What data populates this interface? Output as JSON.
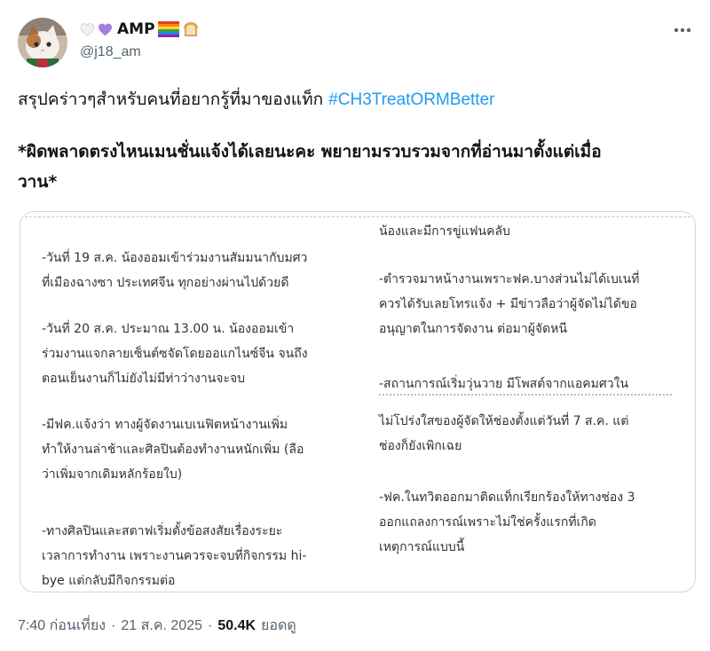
{
  "user": {
    "display_name": "AMP",
    "handle": "@j18_am"
  },
  "icons": {
    "more": "more-dots-icon",
    "heart_white": "white-heart-icon",
    "heart_purple": "purple-heart-icon",
    "flag": "rainbow-flag-icon",
    "bread": "bread-icon",
    "avatar": "cat-avatar"
  },
  "colors": {
    "hashtag": "#1d9bf0",
    "secondary": "#536471",
    "border": "#cfd9de"
  },
  "tweet": {
    "line1_text": "สรุปคร่าวๆสำหรับคนที่อยากรู้ที่มาของแท็ก ",
    "hashtag": "#CH3TreatORMBetter",
    "note_line1": "*ผิดพลาดตรงไหนเมนชั่นแจ้งได้เลยนะคะ พยายามรวบรวมจากที่อ่านมาตั้งแต่เมื่อ",
    "note_line2": "วาน*"
  },
  "media": {
    "left": [
      [
        "-วันที่ 19 ส.ค. น้องออมเข้าร่วมงานสัมมนากับมศว",
        "ที่เมืองฉางซา ประเทศจีน ทุกอย่างผ่านไปด้วยดี"
      ],
      [
        "-วันที่ 20 ส.ค. ประมาณ 13.00 น. น้องออมเข้า",
        "ร่วมงานแจกลายเซ็นต์ซจัดโดยออแกไนซ์จีน จนถึง",
        "ตอนเย็นงานก็ไม่ยังไม่มีท่าว่างานจะจบ"
      ],
      [
        "-มีฟค.แจ้งว่า ทางผู้จัดงานเบเนฟิตหน้างานเพิ่ม",
        "ทำให้งานล่าช้าและศิลปินต้องทำงานหนักเพิ่ม (ลือ",
        "ว่าเพิ่มจากเดิมหลักร้อยใบ)"
      ],
      [
        "-ทางศิลปินและสตาฟเริ่มตั้งข้อสงสัยเรื่องระยะ",
        "เวลาการทำงาน เพราะงานควรจะจบที่กิจกรรม hi-",
        "bye แต่กลับมีกิจกรรมต่อ"
      ]
    ],
    "right": [
      [
        "น้องและมีการขู่แฟนคลับ"
      ],
      [
        "-ตำรวจมาหน้างานเพราะฟค.บางส่วนไม่ได้เบเนที่",
        "ควรได้รับเลยโทรแจ้ง + มีข่าวลือว่าผู้จัดไม่ได้ขอ",
        "อนุญาตในการจัดงาน ต่อมาผู้จัดหนี"
      ],
      [
        "-สถานการณ์เริ่มวุ่นวาย มีโพสต์จากแอคมศวใน"
      ],
      [
        "ไม่โปร่งใสของผู้จัดให้ช่องตั้งแต่วันที่ 7 ส.ค. แต่",
        "ช่องก็ยังเพิกเฉย"
      ],
      [
        "-ฟค.ในทวิตออกมาติดแท็กเรียกร้องให้ทางช่อง 3",
        "ออกแถลงการณ์เพราะไม่ใช่ครั้งแรกที่เกิด",
        "เหตุการณ์แบบนี้"
      ]
    ]
  },
  "meta": {
    "time": "7:40 ก่อนเที่ยง",
    "sep1": "·",
    "date": "21 ส.ค. 2025",
    "sep2": "·",
    "views": "50.4K",
    "views_label": "ยอดดู"
  }
}
